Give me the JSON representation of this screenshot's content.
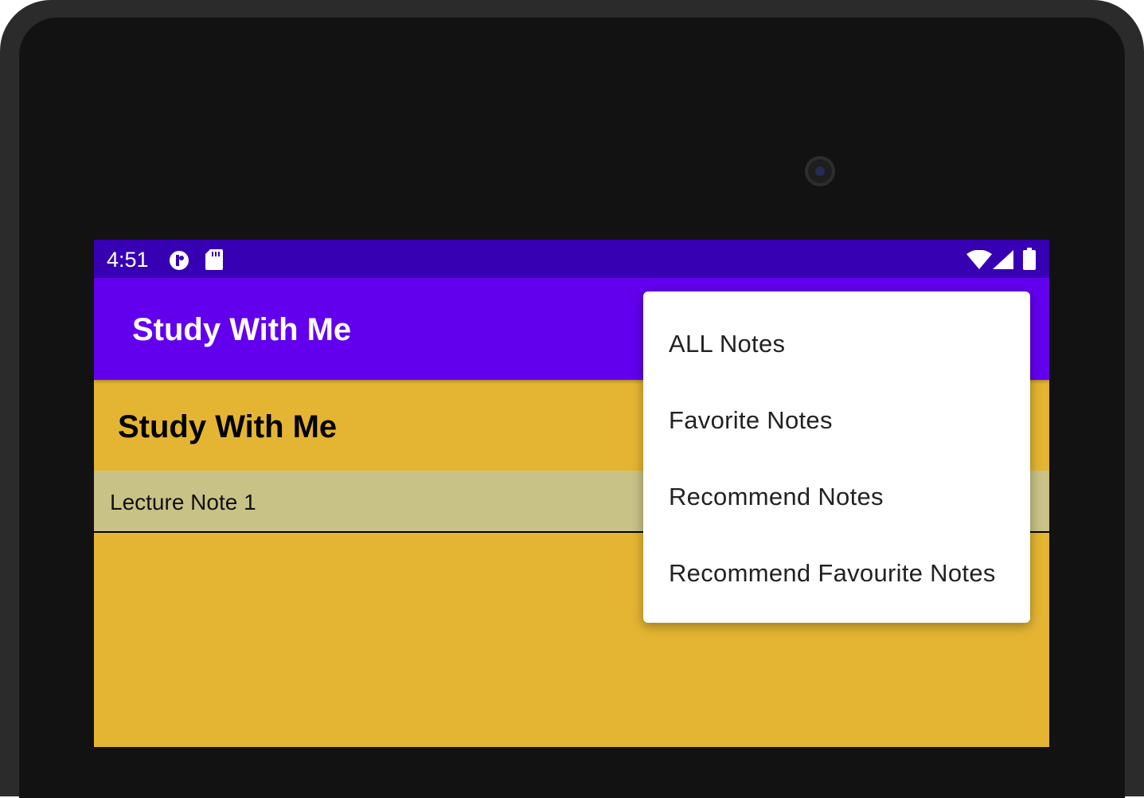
{
  "status_bar": {
    "time": "4:51",
    "icons": [
      "data-saver-icon",
      "sd-card-icon",
      "wifi-icon",
      "cell-signal-icon",
      "battery-icon"
    ]
  },
  "app_bar": {
    "title": "Study With Me"
  },
  "content": {
    "header": "Study With Me",
    "notes": [
      {
        "label": "Lecture Note 1"
      }
    ]
  },
  "menu": {
    "items": [
      {
        "label": "ALL Notes"
      },
      {
        "label": "Favorite Notes"
      },
      {
        "label": "Recommend Notes"
      },
      {
        "label": "Recommend Favourite Notes"
      }
    ]
  },
  "colors": {
    "status_bar": "#3700b3",
    "app_bar": "#6200ee",
    "background": "#e4b532",
    "note_row": "#c8c287",
    "menu_bg": "#ffffff"
  }
}
